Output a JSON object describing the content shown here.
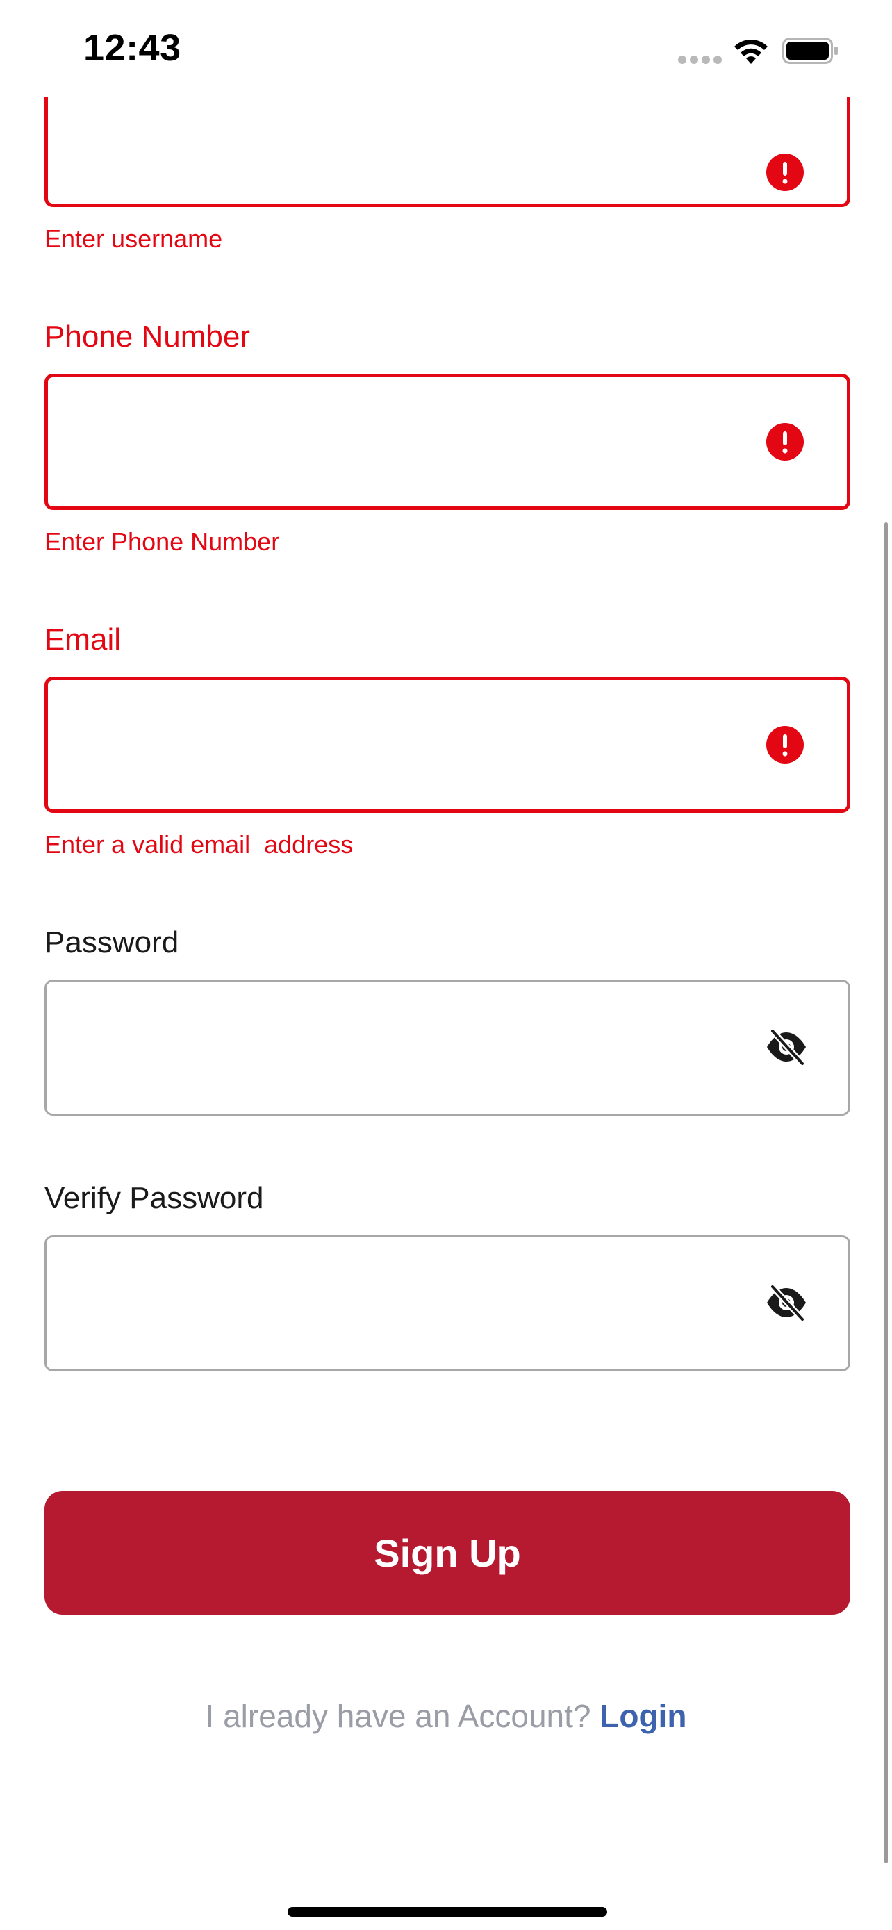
{
  "status_bar": {
    "time": "12:43",
    "signal_icon": "cellular-dots-icon",
    "wifi_icon": "wifi-icon",
    "battery_icon": "battery-icon"
  },
  "form": {
    "username": {
      "value": "",
      "error": "Enter username",
      "status_icon": "error-icon"
    },
    "phone": {
      "label": "Phone Number",
      "value": "",
      "error": "Enter Phone Number",
      "status_icon": "error-icon"
    },
    "email": {
      "label": "Email",
      "value": "",
      "error": "Enter a valid email  address",
      "status_icon": "error-icon"
    },
    "password": {
      "label": "Password",
      "value": "",
      "toggle_icon": "eye-slash-icon"
    },
    "verify_password": {
      "label": "Verify Password",
      "value": "",
      "toggle_icon": "eye-slash-icon"
    }
  },
  "actions": {
    "signup_label": "Sign Up",
    "login_prompt": "I already have an Account?",
    "login_link": "Login"
  },
  "colors": {
    "error": "#e30613",
    "primary_button": "#b51a30",
    "link": "#3d63ae",
    "muted_text": "#9a9ca6",
    "field_border": "#a7a7a7"
  }
}
